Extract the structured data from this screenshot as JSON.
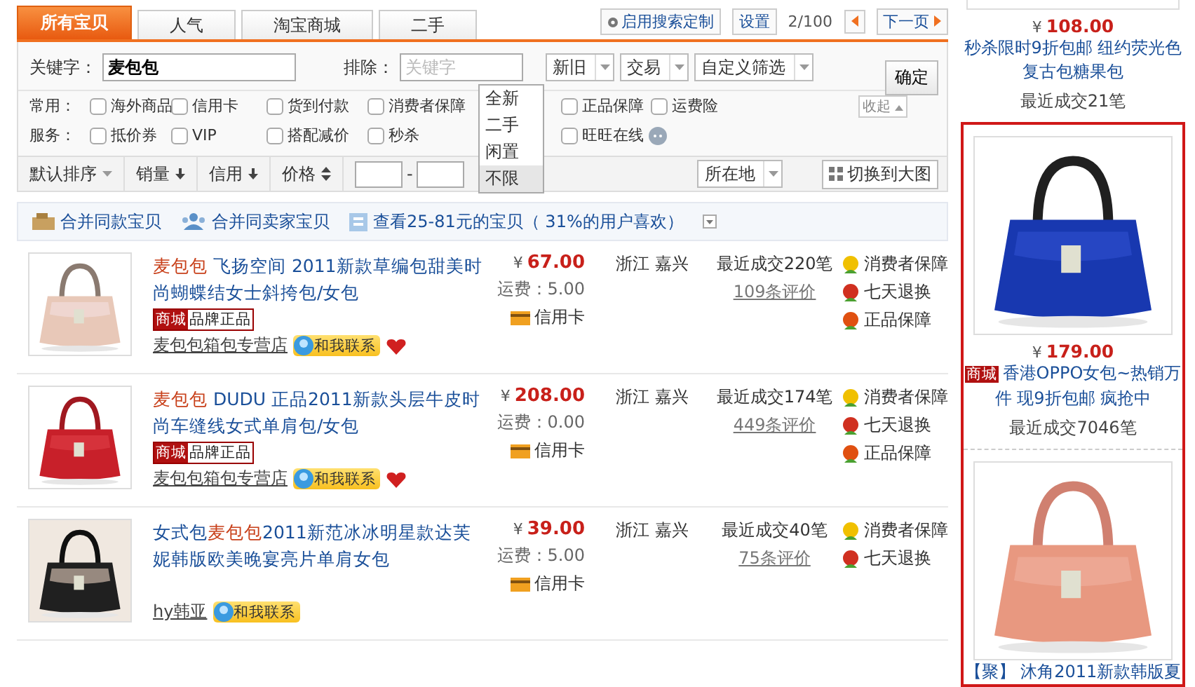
{
  "tabs": [
    {
      "label": "所有宝贝",
      "selected": true
    },
    {
      "label": "人气",
      "selected": false
    },
    {
      "label": "淘宝商城",
      "selected": false
    },
    {
      "label": "二手",
      "selected": false
    }
  ],
  "top_actions": {
    "customize": "启用搜索定制",
    "settings": "设置",
    "page": "2/100",
    "next": "下一页"
  },
  "filter": {
    "keyword_label": "关键字：",
    "keyword": "麦包包",
    "exclude_label": "排除：",
    "exclude_placeholder": "关键字",
    "selects": [
      "新旧",
      "交易",
      "自定义筛选"
    ],
    "confirm": "确定",
    "collapse": "收起",
    "condition_menu": [
      {
        "label": "全新",
        "selected": false
      },
      {
        "label": "二手",
        "selected": false
      },
      {
        "label": "闲置",
        "selected": false
      },
      {
        "label": "不限",
        "selected": true
      }
    ],
    "option_rows": [
      {
        "label": "常用：",
        "options": [
          {
            "label": "海外商品",
            "checked": false
          },
          {
            "label": "信用卡",
            "checked": false
          },
          {
            "label": "货到付款",
            "checked": false
          },
          {
            "label": "消费者保障",
            "checked": false
          },
          {
            "label": "正品保障",
            "checked": false
          },
          {
            "label": "运费险",
            "checked": false
          }
        ]
      },
      {
        "label": "服务：",
        "options": [
          {
            "label": "抵价券",
            "checked": false
          },
          {
            "label": "VIP",
            "checked": false
          },
          {
            "label": "搭配减价",
            "checked": false
          },
          {
            "label": "秒杀",
            "checked": false
          },
          {
            "label": "旺旺在线",
            "checked": false
          }
        ]
      }
    ]
  },
  "sort_bar": {
    "items": [
      {
        "label": "默认排序",
        "kind": "dropdown"
      },
      {
        "label": "销量",
        "kind": "down"
      },
      {
        "label": "信用",
        "kind": "down"
      },
      {
        "label": "价格",
        "kind": "updown"
      }
    ],
    "price_separator": "-",
    "location": "所在地",
    "switch": "切换到大图"
  },
  "merge_bar": [
    {
      "label": "合并同款宝贝",
      "kind": "same-item"
    },
    {
      "label": "合并同卖家宝贝",
      "kind": "same-seller"
    },
    {
      "label": "查看25-81元的宝贝（ 31%的用户喜欢）",
      "kind": "price-range"
    }
  ],
  "results": [
    {
      "title": [
        {
          "text": "麦包包",
          "highlight": true
        },
        {
          "text": " 飞扬空间 2011新款草编包甜美时尚蝴蝶结女士斜挎包/女包",
          "highlight": false
        }
      ],
      "badge": {
        "mall": "商城",
        "label": "品牌正品"
      },
      "shop": "麦包包箱包专营店",
      "contact": "和我联系",
      "heart": true,
      "currency": "¥",
      "price": "67.00",
      "shipping": "运费：5.00",
      "payment": "信用卡",
      "location": "浙江 嘉兴",
      "sales": "最近成交220笔",
      "reviews": "109条评价",
      "services": [
        {
          "kind": "consumer",
          "label": "消费者保障"
        },
        {
          "kind": "return",
          "label": "七天退换"
        },
        {
          "kind": "genuine",
          "label": "正品保障"
        }
      ]
    },
    {
      "title": [
        {
          "text": "麦包包",
          "highlight": true
        },
        {
          "text": " DUDU 正品2011新款头层牛皮时尚车缝线女式单肩包/女包",
          "highlight": false
        }
      ],
      "badge": {
        "mall": "商城",
        "label": "品牌正品"
      },
      "shop": "麦包包箱包专营店",
      "contact": "和我联系",
      "heart": true,
      "currency": "¥",
      "price": "208.00",
      "shipping": "运费：0.00",
      "payment": "信用卡",
      "location": "浙江 嘉兴",
      "sales": "最近成交174笔",
      "reviews": "449条评价",
      "services": [
        {
          "kind": "consumer",
          "label": "消费者保障"
        },
        {
          "kind": "return",
          "label": "七天退换"
        },
        {
          "kind": "genuine",
          "label": "正品保障"
        }
      ]
    },
    {
      "title": [
        {
          "text": "女式包",
          "highlight": false
        },
        {
          "text": "麦包包",
          "highlight": true
        },
        {
          "text": "2011新范冰冰明星款达芙妮韩版欧美晚宴亮片单肩女包",
          "highlight": false
        }
      ],
      "shop": "hy韩亚",
      "contact": "和我联系",
      "heart": false,
      "currency": "¥",
      "price": "39.00",
      "shipping": "运费：5.00",
      "payment": "信用卡",
      "location": "浙江 嘉兴",
      "sales": "最近成交40笔",
      "reviews": "75条评价",
      "services": [
        {
          "kind": "consumer",
          "label": "消费者保障"
        },
        {
          "kind": "return",
          "label": "七天退换"
        }
      ]
    }
  ],
  "sidebar": {
    "top_item": {
      "currency": "¥",
      "price": "108.00",
      "title": "秒杀限时9折包邮 纽约荧光色复古包糖果包",
      "sales": "最近成交21笔"
    },
    "featured": [
      {
        "currency": "¥",
        "price": "179.00",
        "badge": "商城",
        "title": "香港OPPO女包~热销万件 现9折包邮 疯抢中",
        "sales": "最近成交7046笔"
      },
      {
        "title": "【聚】 沐角2011新款韩版夏"
      }
    ]
  }
}
